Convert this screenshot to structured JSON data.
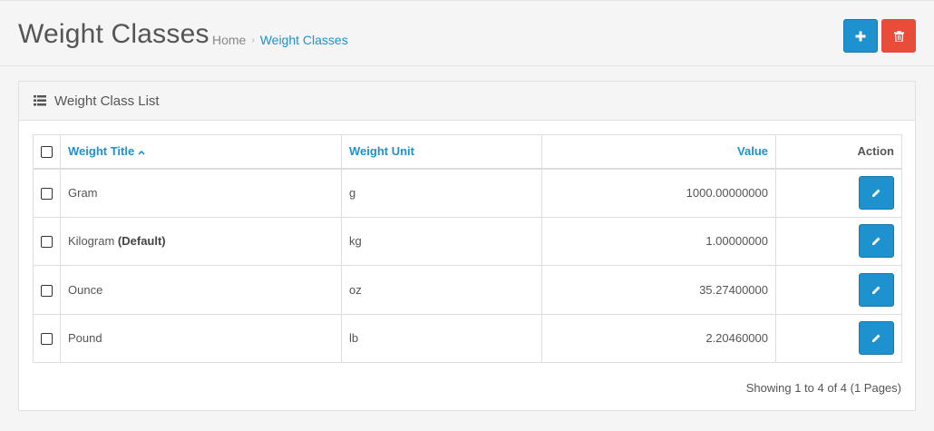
{
  "header": {
    "title": "Weight Classes",
    "breadcrumb": [
      {
        "label": "Home"
      },
      {
        "label": "Weight Classes"
      }
    ],
    "actions": {
      "add_icon": "plus-icon",
      "delete_icon": "trash-icon"
    }
  },
  "panel": {
    "title": "Weight Class List",
    "icon": "list-icon"
  },
  "table": {
    "columns": {
      "title": "Weight Title",
      "unit": "Weight Unit",
      "value": "Value",
      "action": "Action"
    },
    "rows": [
      {
        "title": "Gram",
        "default_label": "",
        "unit": "g",
        "value": "1000.00000000"
      },
      {
        "title": "Kilogram",
        "default_label": "(Default)",
        "unit": "kg",
        "value": "1.00000000"
      },
      {
        "title": "Ounce",
        "default_label": "",
        "unit": "oz",
        "value": "35.27400000"
      },
      {
        "title": "Pound",
        "default_label": "",
        "unit": "lb",
        "value": "2.20460000"
      }
    ]
  },
  "pagination": {
    "summary": "Showing 1 to 4 of 4 (1 Pages)"
  },
  "colors": {
    "primary": "#1e91cf",
    "danger": "#ea4c3a"
  }
}
